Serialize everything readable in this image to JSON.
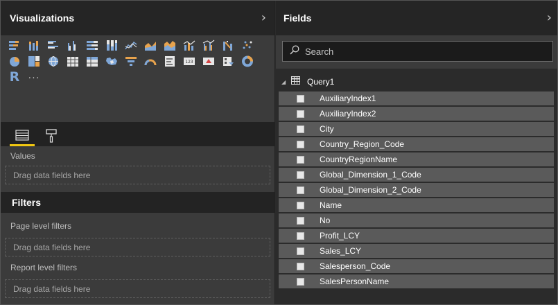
{
  "visualizations": {
    "title": "Visualizations",
    "icons": [
      "stacked-bar-chart-icon",
      "stacked-column-chart-icon",
      "clustered-bar-chart-icon",
      "clustered-column-chart-icon",
      "100-stacked-bar-chart-icon",
      "100-stacked-column-chart-icon",
      "line-chart-icon",
      "area-chart-icon",
      "stacked-area-chart-icon",
      "line-and-stacked-column-chart-icon",
      "line-and-clustered-column-chart-icon",
      "ribbon-chart-icon",
      "scatter-chart-icon",
      "pie-chart-icon",
      "treemap-icon",
      "map-icon",
      "table-icon",
      "matrix-icon",
      "filled-map-icon",
      "funnel-icon",
      "gauge-icon",
      "multi-row-card-icon",
      "card-icon",
      "kpi-icon",
      "slicer-icon",
      "donut-chart-icon",
      "r-visual-icon",
      "more-visuals-icon"
    ],
    "r_label": "R",
    "more_label": "···",
    "tabs": [
      "fields-tab-icon",
      "format-tab-icon"
    ],
    "values_label": "Values",
    "values_drop": "Drag data fields here"
  },
  "filters": {
    "title": "Filters",
    "page_level_label": "Page level filters",
    "page_level_drop": "Drag data fields here",
    "report_level_label": "Report level filters",
    "report_level_drop": "Drag data fields here"
  },
  "fields": {
    "title": "Fields",
    "search_placeholder": "Search",
    "query_name": "Query1",
    "items": [
      "AuxiliaryIndex1",
      "AuxiliaryIndex2",
      "City",
      "Country_Region_Code",
      "CountryRegionName",
      "Global_Dimension_1_Code",
      "Global_Dimension_2_Code",
      "Name",
      "No",
      "Profit_LCY",
      "Sales_LCY",
      "Salesperson_Code",
      "SalesPersonName"
    ]
  },
  "colors": {
    "accent": "#f2c811",
    "icon_blue": "#7fa7d8",
    "icon_orange": "#e8a34d"
  }
}
